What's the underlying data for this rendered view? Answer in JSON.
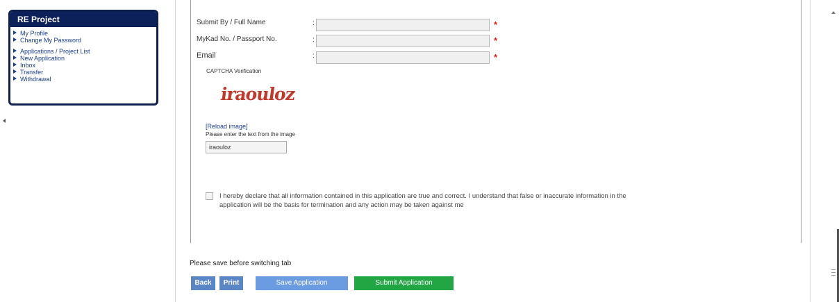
{
  "sidebar": {
    "title": "RE Project",
    "items": [
      {
        "label": "My Profile"
      },
      {
        "label": "Change My Password"
      },
      {
        "label": "Applications / Project List"
      },
      {
        "label": "New Application"
      },
      {
        "label": "Inbox"
      },
      {
        "label": "Transfer"
      },
      {
        "label": "Withdrawal"
      }
    ]
  },
  "form": {
    "fields": [
      {
        "label": "Submit By / Full Name",
        "value": ""
      },
      {
        "label": "MyKad No. / Passport No.",
        "value": ""
      },
      {
        "label": "Email",
        "value": ""
      }
    ],
    "colon": ":",
    "required_mark": "*",
    "captcha": {
      "label": "CAPTCHA Verification",
      "image_text": "iraouloz",
      "reload_link": "[Reload image]",
      "help": "Please enter the text from the image",
      "input_value": "iraouloz"
    },
    "declaration": {
      "line1": "I hereby declare that all information contained in this application are true and correct. I understand that false or inaccurate information in the",
      "line2": "application will be the basis for termination and any action may be taken against me",
      "checked": false
    }
  },
  "footer": {
    "note": "Please save before switching tab",
    "buttons": {
      "back": "Back",
      "print": "Print",
      "save": "Save Application",
      "submit": "Submit Application"
    }
  },
  "colors": {
    "sidebar_header": "#0c2059",
    "link": "#1a3e90",
    "required": "#e02020",
    "button_blue": "#5a86c5",
    "button_save": "#6b9be0",
    "button_submit": "#21a643",
    "captcha": "#c0392b"
  }
}
